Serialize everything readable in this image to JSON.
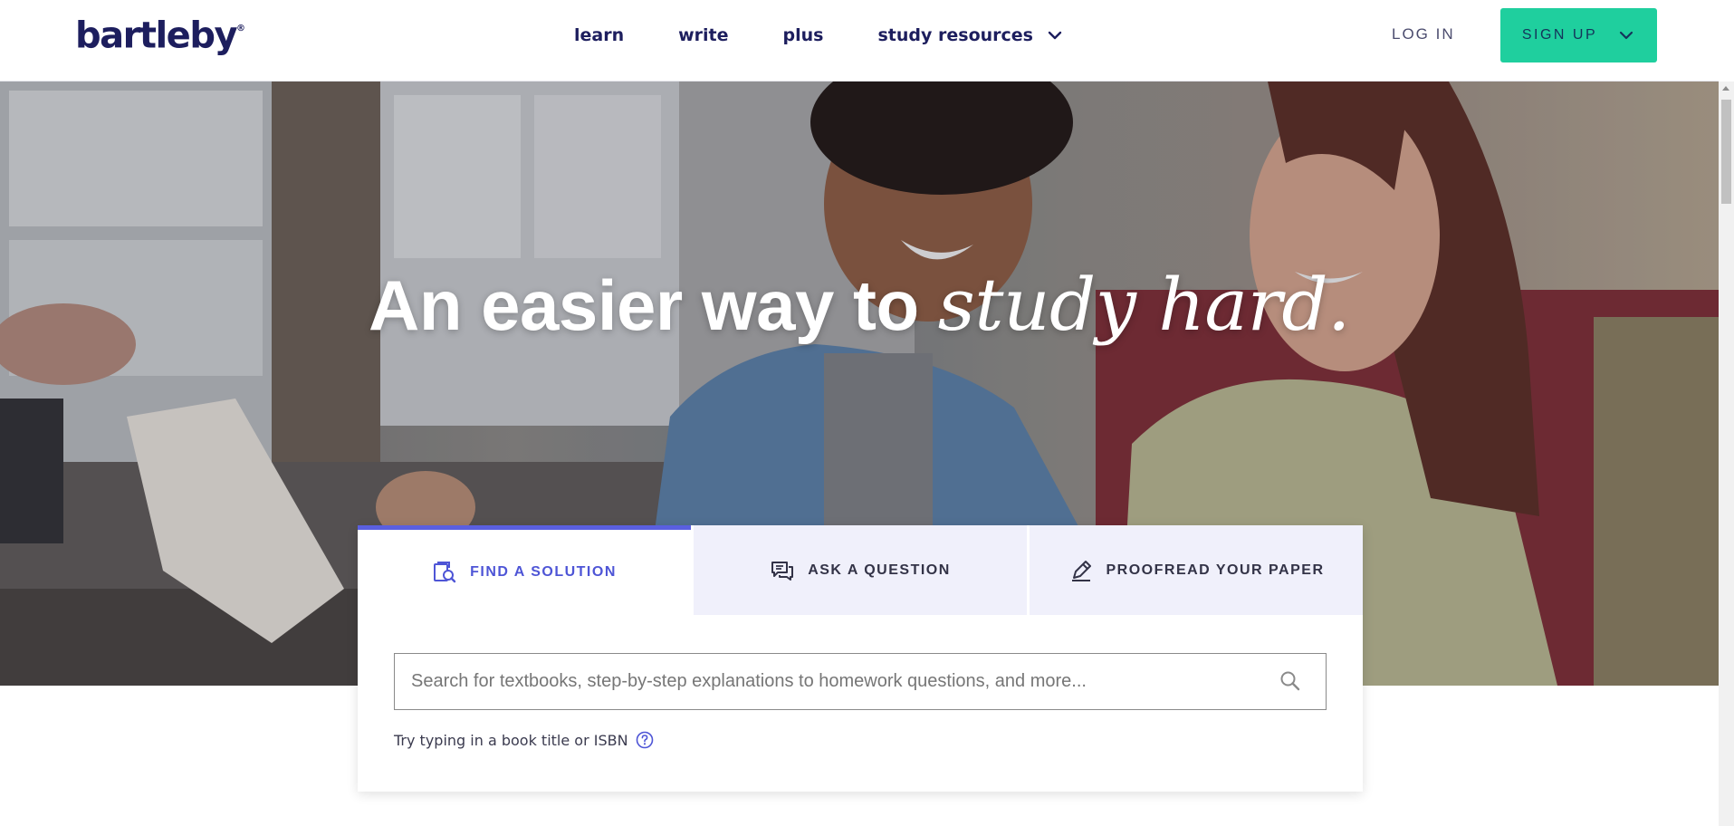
{
  "brand": {
    "logo_text": "bartleby",
    "logo_mark": "®"
  },
  "header": {
    "nav": [
      {
        "label": "learn"
      },
      {
        "label": "write"
      },
      {
        "label": "plus"
      }
    ],
    "dropdown_label": "study resources",
    "login_label": "LOG IN",
    "signup_label": "SIGN UP"
  },
  "hero": {
    "title_plain": "An easier way to",
    "title_emphasis": "study hard."
  },
  "search_card": {
    "tabs": [
      {
        "label": "FIND A SOLUTION",
        "icon": "find-solution-icon",
        "active": true
      },
      {
        "label": "ASK A QUESTION",
        "icon": "chat-bubbles-icon",
        "active": false
      },
      {
        "label": "PROOFREAD YOUR PAPER",
        "icon": "pencil-icon",
        "active": false
      }
    ],
    "search_placeholder": "Search for textbooks, step-by-step explanations to homework questions, and more...",
    "search_value": "",
    "hint_text": "Try typing in a book title or ISBN"
  },
  "colors": {
    "brand_navy": "#1d1e5e",
    "signup_green": "#1fcf9e",
    "active_tab_accent": "#5a5fe0",
    "inactive_tab_bg": "#f0f0fb"
  }
}
